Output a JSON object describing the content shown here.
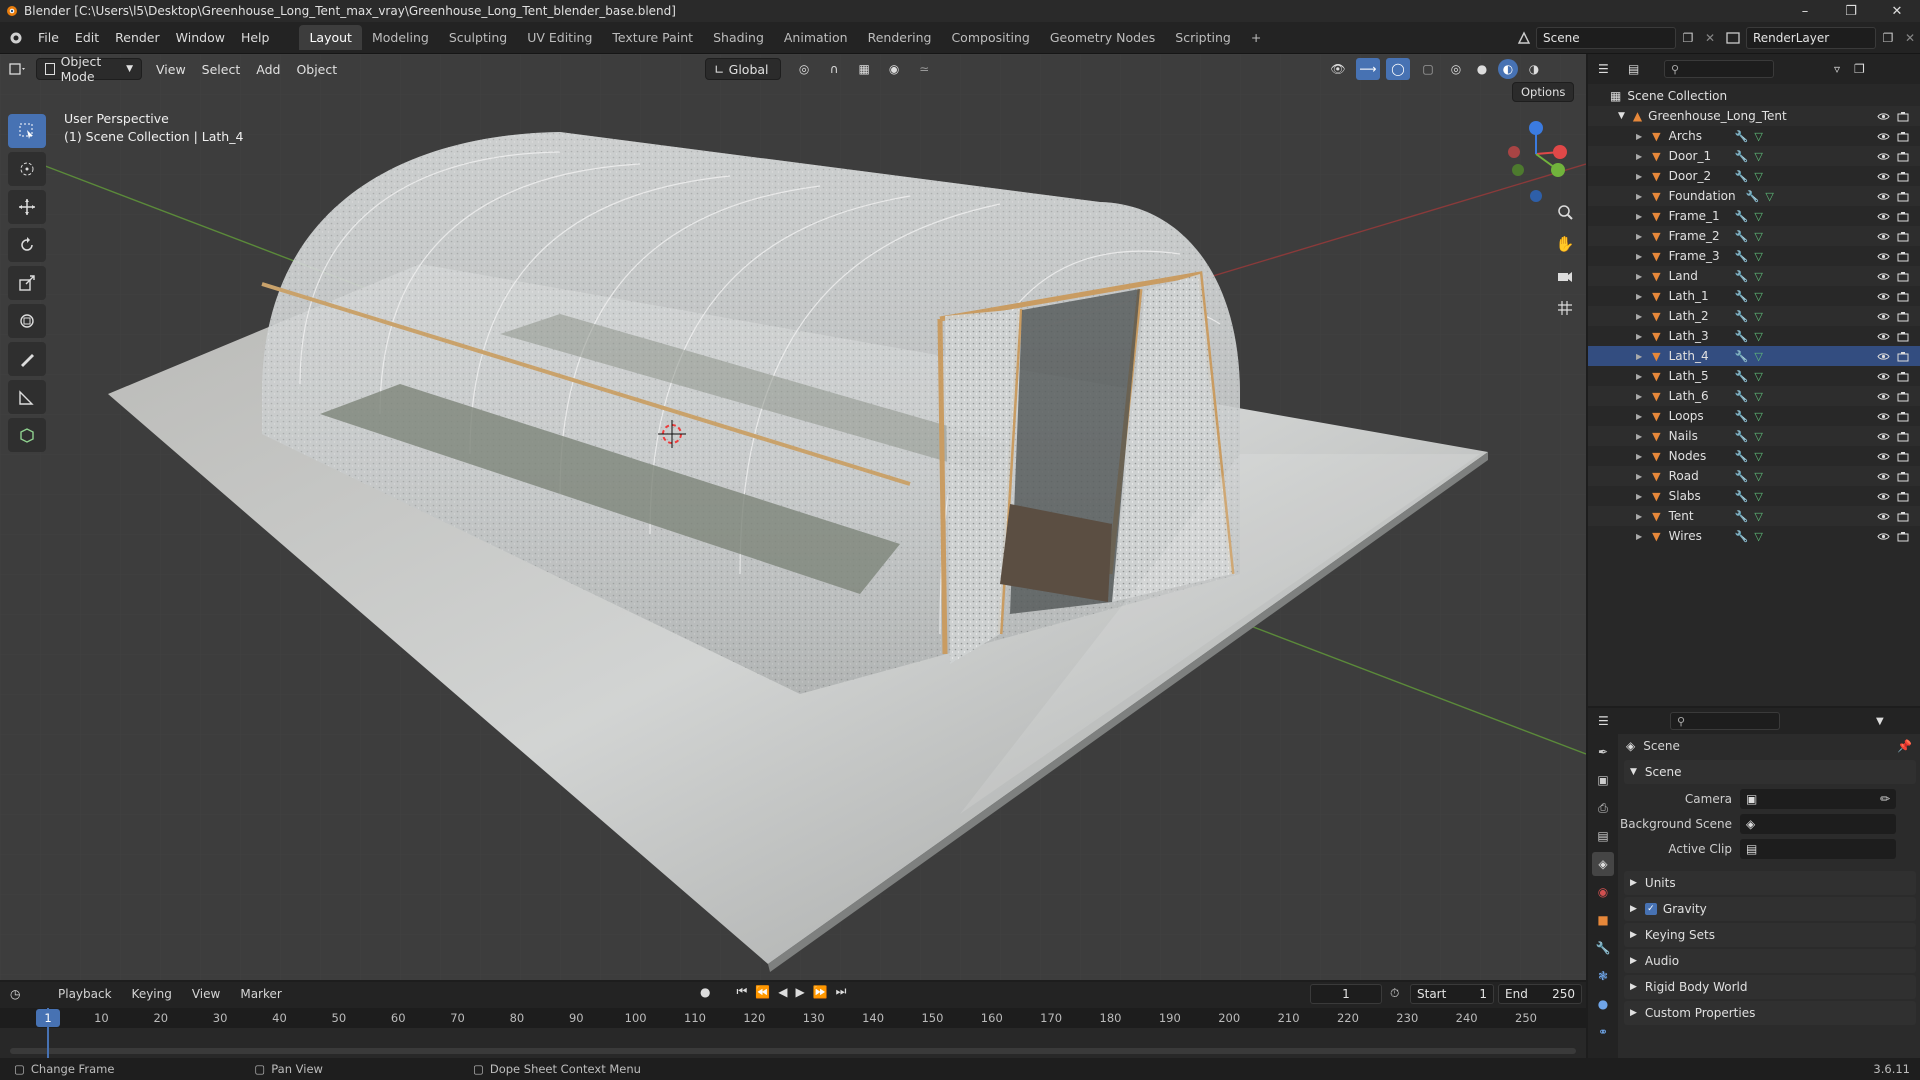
{
  "window": {
    "title": "Blender [C:\\Users\\l5\\Desktop\\Greenhouse_Long_Tent_max_vray\\Greenhouse_Long_Tent_blender_base.blend]"
  },
  "menu": [
    "File",
    "Edit",
    "Render",
    "Window",
    "Help"
  ],
  "workspaces": [
    "Layout",
    "Modeling",
    "Sculpting",
    "UV Editing",
    "Texture Paint",
    "Shading",
    "Animation",
    "Rendering",
    "Compositing",
    "Geometry Nodes",
    "Scripting"
  ],
  "active_workspace": "Layout",
  "scene_field": "Scene",
  "view_layer_field": "RenderLayer",
  "viewport": {
    "mode": "Object Mode",
    "menus": [
      "View",
      "Select",
      "Add",
      "Object"
    ],
    "transform_orientation": "Global",
    "options_label": "Options",
    "overlay_title": "User Perspective",
    "overlay_subtitle": "(1) Scene Collection | Lath_4",
    "gizmo_axes": {
      "x": "X",
      "y": "Y",
      "z": "Z"
    }
  },
  "outliner": {
    "root": "Scene Collection",
    "collection": "Greenhouse_Long_Tent",
    "objects": [
      "Archs",
      "Door_1",
      "Door_2",
      "Foundation",
      "Frame_1",
      "Frame_2",
      "Frame_3",
      "Land",
      "Lath_1",
      "Lath_2",
      "Lath_3",
      "Lath_4",
      "Lath_5",
      "Lath_6",
      "Loops",
      "Nails",
      "Nodes",
      "Road",
      "Slabs",
      "Tent",
      "Wires"
    ],
    "active_object": "Lath_4"
  },
  "properties": {
    "context_label": "Scene",
    "panel_scene": "Scene",
    "camera_label": "Camera",
    "background_scene_label": "Background Scene",
    "active_clip_label": "Active Clip",
    "panels": [
      "Units",
      "Gravity",
      "Keying Sets",
      "Audio",
      "Rigid Body World",
      "Custom Properties"
    ],
    "gravity_checked": true
  },
  "timeline": {
    "menus": [
      "Playback",
      "Keying",
      "View",
      "Marker"
    ],
    "current_frame": "1",
    "start_label": "Start",
    "start": "1",
    "end_label": "End",
    "end": "250",
    "ticks": [
      "1",
      "10",
      "20",
      "30",
      "40",
      "50",
      "60",
      "70",
      "80",
      "90",
      "100",
      "110",
      "120",
      "130",
      "140",
      "150",
      "160",
      "170",
      "180",
      "190",
      "200",
      "210",
      "220",
      "230",
      "240",
      "250"
    ]
  },
  "statusbar": {
    "left": "Change Frame",
    "middle": "Pan View",
    "right": "Dope Sheet Context Menu",
    "version": "3.6.11"
  },
  "colors": {
    "accent": "#4772b3",
    "object_orange": "#e7883a",
    "mesh_green": "#5fbf7a",
    "wrench_blue": "#6fa5e8"
  }
}
